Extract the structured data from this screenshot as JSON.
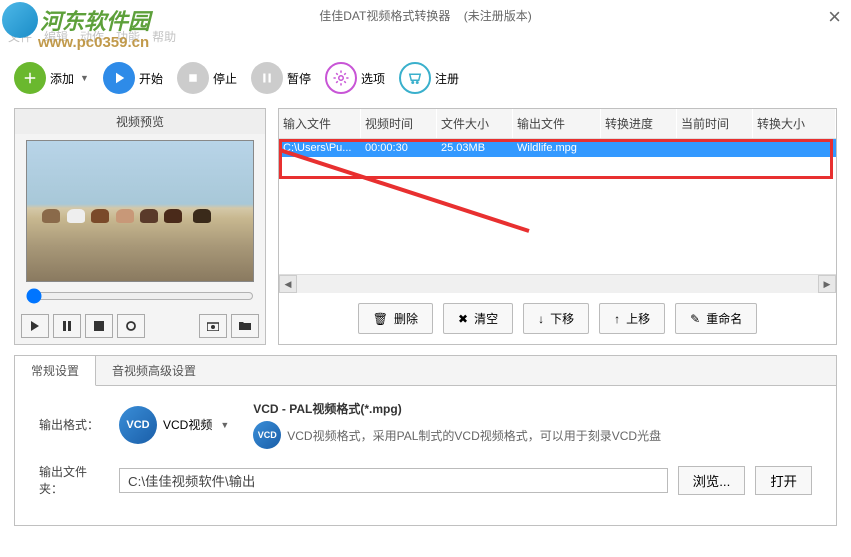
{
  "window": {
    "title": "佳佳DAT视频格式转换器",
    "subtitle": "(未注册版本)"
  },
  "watermark": {
    "brand": "河东软件园",
    "url": "www.pc0359.cn"
  },
  "menu": {
    "file": "文件",
    "edit": "编辑",
    "action": "动作",
    "function": "功能",
    "help": "帮助"
  },
  "toolbar": {
    "add": "添加",
    "start": "开始",
    "stop": "停止",
    "pause": "暂停",
    "options": "选项",
    "register": "注册"
  },
  "preview": {
    "title": "视频预览"
  },
  "list": {
    "headers": {
      "input": "输入文件",
      "duration": "视频时间",
      "size": "文件大小",
      "output": "输出文件",
      "progress": "转换进度",
      "curtime": "当前时间",
      "outsize": "转换大小"
    },
    "rows": [
      {
        "input": "C:\\Users\\Pu...",
        "duration": "00:00:30",
        "size": "25.03MB",
        "output": "Wildlife.mpg",
        "progress": "",
        "curtime": "",
        "outsize": ""
      }
    ],
    "buttons": {
      "delete": "删除",
      "clear": "清空",
      "movedown": "下移",
      "moveup": "上移",
      "rename": "重命名"
    }
  },
  "settings": {
    "tabs": {
      "general": "常规设置",
      "advanced": "音视频高级设置"
    },
    "format_label": "输出格式：",
    "format_name": "VCD视频",
    "format_title": "VCD - PAL视频格式(*.mpg)",
    "format_desc": "VCD视频格式，采用PAL制式的VCD视频格式，可以用于刻录VCD光盘",
    "vcd_badge": "VCD",
    "folder_label": "输出文件夹：",
    "folder_path": "C:\\佳佳视频软件\\输出",
    "browse": "浏览...",
    "open": "打开"
  }
}
